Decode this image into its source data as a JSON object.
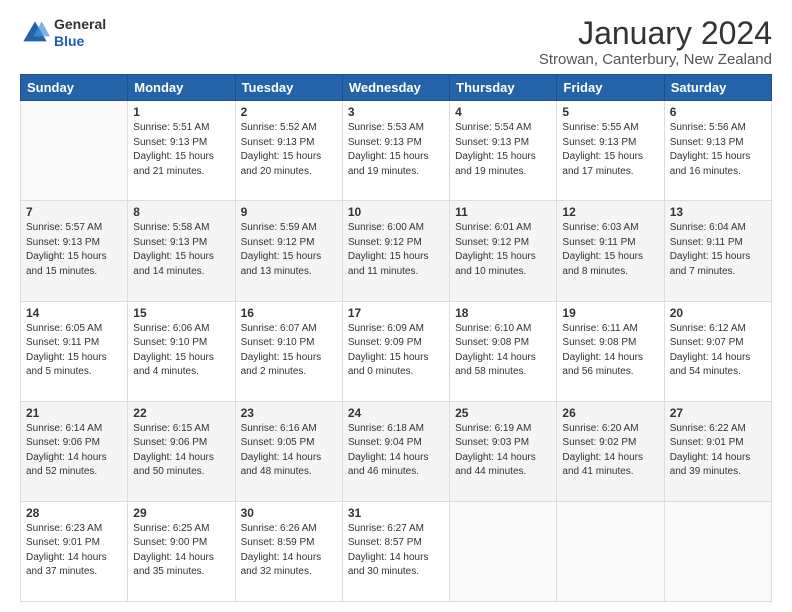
{
  "header": {
    "logo_line1": "General",
    "logo_line2": "Blue",
    "month_title": "January 2024",
    "location": "Strowan, Canterbury, New Zealand"
  },
  "weekdays": [
    "Sunday",
    "Monday",
    "Tuesday",
    "Wednesday",
    "Thursday",
    "Friday",
    "Saturday"
  ],
  "weeks": [
    [
      {
        "day": "",
        "info": ""
      },
      {
        "day": "1",
        "info": "Sunrise: 5:51 AM\nSunset: 9:13 PM\nDaylight: 15 hours\nand 21 minutes."
      },
      {
        "day": "2",
        "info": "Sunrise: 5:52 AM\nSunset: 9:13 PM\nDaylight: 15 hours\nand 20 minutes."
      },
      {
        "day": "3",
        "info": "Sunrise: 5:53 AM\nSunset: 9:13 PM\nDaylight: 15 hours\nand 19 minutes."
      },
      {
        "day": "4",
        "info": "Sunrise: 5:54 AM\nSunset: 9:13 PM\nDaylight: 15 hours\nand 19 minutes."
      },
      {
        "day": "5",
        "info": "Sunrise: 5:55 AM\nSunset: 9:13 PM\nDaylight: 15 hours\nand 17 minutes."
      },
      {
        "day": "6",
        "info": "Sunrise: 5:56 AM\nSunset: 9:13 PM\nDaylight: 15 hours\nand 16 minutes."
      }
    ],
    [
      {
        "day": "7",
        "info": "Sunrise: 5:57 AM\nSunset: 9:13 PM\nDaylight: 15 hours\nand 15 minutes."
      },
      {
        "day": "8",
        "info": "Sunrise: 5:58 AM\nSunset: 9:13 PM\nDaylight: 15 hours\nand 14 minutes."
      },
      {
        "day": "9",
        "info": "Sunrise: 5:59 AM\nSunset: 9:12 PM\nDaylight: 15 hours\nand 13 minutes."
      },
      {
        "day": "10",
        "info": "Sunrise: 6:00 AM\nSunset: 9:12 PM\nDaylight: 15 hours\nand 11 minutes."
      },
      {
        "day": "11",
        "info": "Sunrise: 6:01 AM\nSunset: 9:12 PM\nDaylight: 15 hours\nand 10 minutes."
      },
      {
        "day": "12",
        "info": "Sunrise: 6:03 AM\nSunset: 9:11 PM\nDaylight: 15 hours\nand 8 minutes."
      },
      {
        "day": "13",
        "info": "Sunrise: 6:04 AM\nSunset: 9:11 PM\nDaylight: 15 hours\nand 7 minutes."
      }
    ],
    [
      {
        "day": "14",
        "info": "Sunrise: 6:05 AM\nSunset: 9:11 PM\nDaylight: 15 hours\nand 5 minutes."
      },
      {
        "day": "15",
        "info": "Sunrise: 6:06 AM\nSunset: 9:10 PM\nDaylight: 15 hours\nand 4 minutes."
      },
      {
        "day": "16",
        "info": "Sunrise: 6:07 AM\nSunset: 9:10 PM\nDaylight: 15 hours\nand 2 minutes."
      },
      {
        "day": "17",
        "info": "Sunrise: 6:09 AM\nSunset: 9:09 PM\nDaylight: 15 hours\nand 0 minutes."
      },
      {
        "day": "18",
        "info": "Sunrise: 6:10 AM\nSunset: 9:08 PM\nDaylight: 14 hours\nand 58 minutes."
      },
      {
        "day": "19",
        "info": "Sunrise: 6:11 AM\nSunset: 9:08 PM\nDaylight: 14 hours\nand 56 minutes."
      },
      {
        "day": "20",
        "info": "Sunrise: 6:12 AM\nSunset: 9:07 PM\nDaylight: 14 hours\nand 54 minutes."
      }
    ],
    [
      {
        "day": "21",
        "info": "Sunrise: 6:14 AM\nSunset: 9:06 PM\nDaylight: 14 hours\nand 52 minutes."
      },
      {
        "day": "22",
        "info": "Sunrise: 6:15 AM\nSunset: 9:06 PM\nDaylight: 14 hours\nand 50 minutes."
      },
      {
        "day": "23",
        "info": "Sunrise: 6:16 AM\nSunset: 9:05 PM\nDaylight: 14 hours\nand 48 minutes."
      },
      {
        "day": "24",
        "info": "Sunrise: 6:18 AM\nSunset: 9:04 PM\nDaylight: 14 hours\nand 46 minutes."
      },
      {
        "day": "25",
        "info": "Sunrise: 6:19 AM\nSunset: 9:03 PM\nDaylight: 14 hours\nand 44 minutes."
      },
      {
        "day": "26",
        "info": "Sunrise: 6:20 AM\nSunset: 9:02 PM\nDaylight: 14 hours\nand 41 minutes."
      },
      {
        "day": "27",
        "info": "Sunrise: 6:22 AM\nSunset: 9:01 PM\nDaylight: 14 hours\nand 39 minutes."
      }
    ],
    [
      {
        "day": "28",
        "info": "Sunrise: 6:23 AM\nSunset: 9:01 PM\nDaylight: 14 hours\nand 37 minutes."
      },
      {
        "day": "29",
        "info": "Sunrise: 6:25 AM\nSunset: 9:00 PM\nDaylight: 14 hours\nand 35 minutes."
      },
      {
        "day": "30",
        "info": "Sunrise: 6:26 AM\nSunset: 8:59 PM\nDaylight: 14 hours\nand 32 minutes."
      },
      {
        "day": "31",
        "info": "Sunrise: 6:27 AM\nSunset: 8:57 PM\nDaylight: 14 hours\nand 30 minutes."
      },
      {
        "day": "",
        "info": ""
      },
      {
        "day": "",
        "info": ""
      },
      {
        "day": "",
        "info": ""
      }
    ]
  ]
}
